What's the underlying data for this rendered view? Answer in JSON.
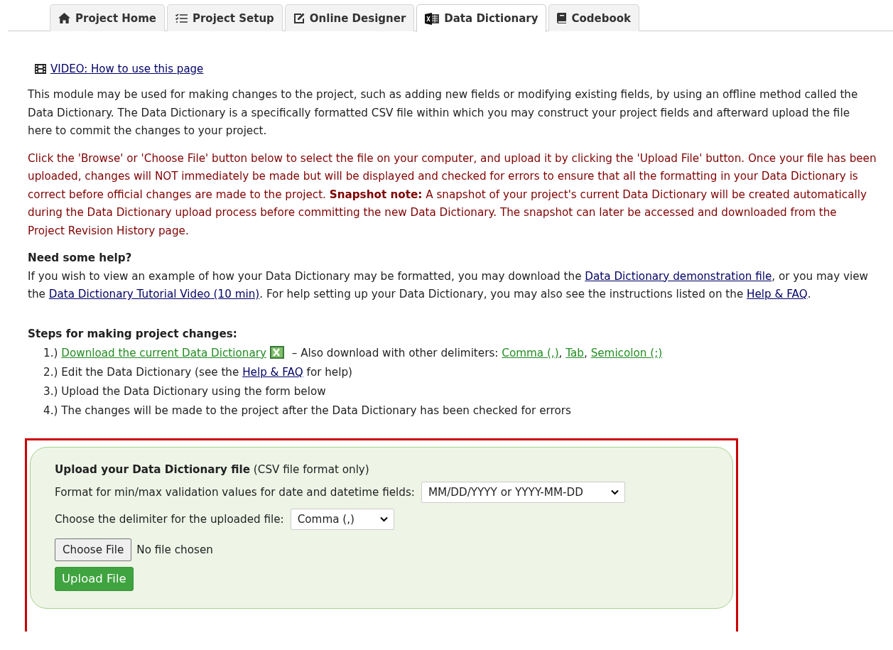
{
  "tabs": [
    {
      "label": "Project Home",
      "kind": "home",
      "selected": false
    },
    {
      "label": "Project Setup",
      "kind": "checklist",
      "selected": false
    },
    {
      "label": "Online Designer",
      "kind": "edit",
      "selected": false
    },
    {
      "label": "Data Dictionary",
      "kind": "excel",
      "selected": true
    },
    {
      "label": "Codebook",
      "kind": "book",
      "selected": false
    }
  ],
  "video_link": "VIDEO: How to use this page",
  "intro": "This module may be used for making changes to the project, such as adding new fields or modifying existing fields, by using an offline method called the Data Dictionary. The Data Dictionary is a specifically formatted CSV file within which you may construct your project fields and afterward upload the file here to commit the changes to your project.",
  "instructions": "Click the 'Browse' or 'Choose File' button below to select the file on your computer, and upload it by clicking the 'Upload File' button. Once your file has been uploaded, changes will NOT immediately be made but will be displayed and checked for errors to ensure that all the formatting in your Data Dictionary is correct before official changes are made to the project. **Snapshot note:** A snapshot of your project's current Data Dictionary will be created automatically during the Data Dictionary upload process before committing the new Data Dictionary. The snapshot can later be accessed and downloaded from the Project Revision History page.",
  "help": {
    "heading": "Need some help?",
    "segments": [
      {
        "kind": "text",
        "text": "If you wish to view an example of how your Data Dictionary may be formatted, you may download the "
      },
      {
        "kind": "link",
        "text": "Data Dictionary demonstration file"
      },
      {
        "kind": "text",
        "text": ", or you may view the "
      },
      {
        "kind": "link",
        "text": "Data Dictionary Tutorial Video (10 min)"
      },
      {
        "kind": "text",
        "text": ". For help setting up your Data Dictionary, you may also see the instructions listed on the "
      },
      {
        "kind": "link",
        "text": "Help & FAQ"
      },
      {
        "kind": "text",
        "text": "."
      }
    ]
  },
  "steps": {
    "heading": "Steps for making project changes:",
    "items": [
      [
        {
          "kind": "text",
          "text": "1.) "
        },
        {
          "kind": "download",
          "text": "Download the current Data Dictionary"
        },
        {
          "kind": "icon"
        },
        {
          "kind": "text",
          "text": " – Also download with other delimiters: "
        },
        {
          "kind": "download",
          "text": "Comma (,)"
        },
        {
          "kind": "text",
          "text": ", "
        },
        {
          "kind": "download",
          "text": "Tab"
        },
        {
          "kind": "text",
          "text": ", "
        },
        {
          "kind": "download",
          "text": "Semicolon (;)"
        }
      ],
      [
        {
          "kind": "text",
          "text": "2.) Edit the Data Dictionary (see the "
        },
        {
          "kind": "link",
          "text": "Help & FAQ"
        },
        {
          "kind": "text",
          "text": " for help)"
        }
      ],
      [
        {
          "kind": "text",
          "text": "3.) Upload the Data Dictionary using the form below"
        }
      ],
      [
        {
          "kind": "text",
          "text": "4.) The changes will be made to the project after the Data Dictionary has been checked for errors"
        }
      ]
    ]
  },
  "upload": {
    "title": "Upload your Data Dictionary file",
    "title_note": "(CSV file format only)",
    "date_label": "Format for min/max validation values for date and datetime fields:",
    "date_value": "MM/DD/YYYY or YYYY-MM-DD",
    "delimiter_label": "Choose the delimiter for the uploaded file:",
    "delimiter_value": "Comma (,)",
    "choose_button": "Choose File",
    "file_status": "No file chosen",
    "upload_button": "Upload File"
  }
}
